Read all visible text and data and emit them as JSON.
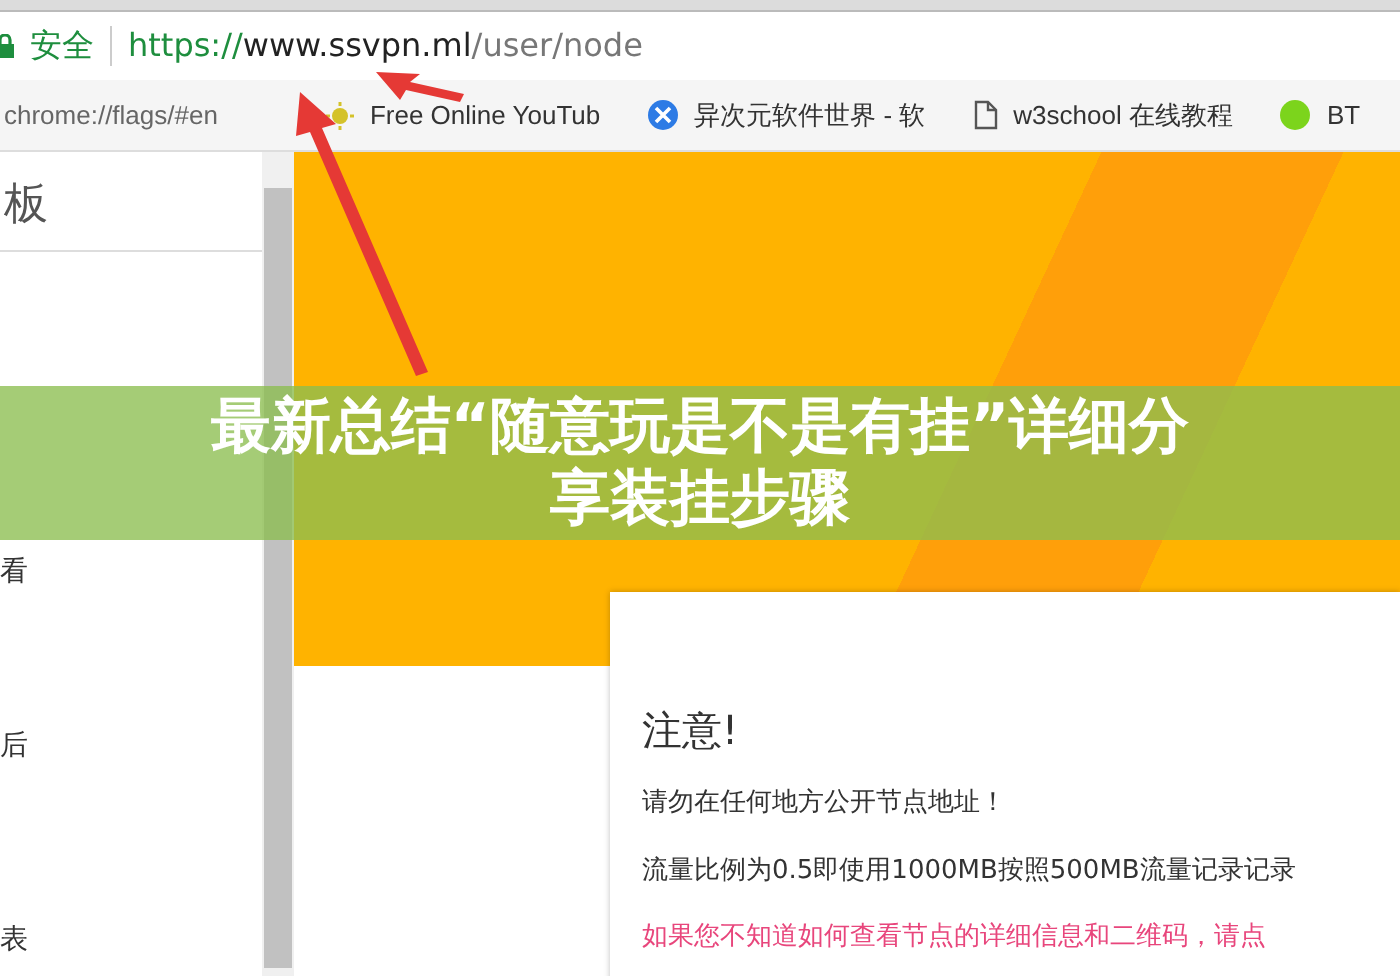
{
  "browser": {
    "security_label": "安全",
    "url": {
      "scheme": "https://",
      "host": "www.ssvpn.ml",
      "path": "/user/node"
    }
  },
  "bookmarks": [
    {
      "kind": "none",
      "label": "chrome://flags/#en"
    },
    {
      "kind": "sun",
      "label": "Free Online YouTub"
    },
    {
      "kind": "logo",
      "label": "异次元软件世界 - 软"
    },
    {
      "kind": "page",
      "label": "w3school 在线教程"
    },
    {
      "kind": "dot",
      "label": "BT"
    }
  ],
  "sidebar": {
    "title": "板",
    "items": [
      "看",
      "后",
      "表"
    ]
  },
  "notice": {
    "heading": "注意!",
    "lines": [
      {
        "kind": "normal",
        "text": "请勿在任何地方公开节点地址！"
      },
      {
        "kind": "normal",
        "text": "流量比例为0.5即使用1000MB按照500MB流量记录记录"
      },
      {
        "kind": "warning",
        "text": "如果您不知道如何查看节点的详细信息和二维码，请点"
      }
    ]
  },
  "overlay_title": "最新总结“随意玩是不是有挂”详细分享装挂步骤"
}
